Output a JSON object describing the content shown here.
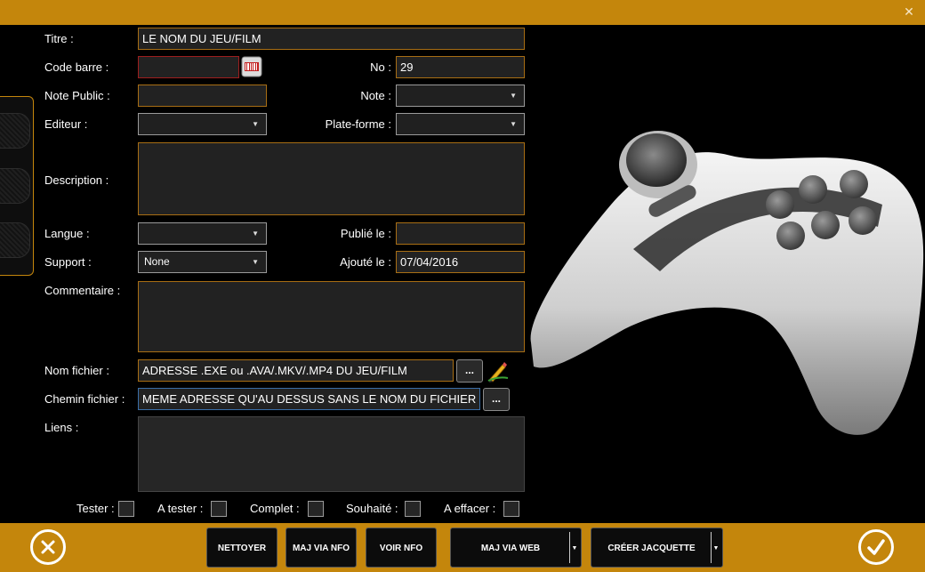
{
  "window": {
    "close_symbol": "✕"
  },
  "form": {
    "titre": {
      "label": "Titre :",
      "value": "LE NOM DU JEU/FILM"
    },
    "code_barre": {
      "label": "Code barre :",
      "value": ""
    },
    "no": {
      "label": "No :",
      "value": "29"
    },
    "note_public": {
      "label": "Note Public :",
      "value": ""
    },
    "note": {
      "label": "Note :",
      "value": ""
    },
    "editeur": {
      "label": "Editeur :",
      "value": ""
    },
    "plateforme": {
      "label": "Plate-forme :",
      "value": ""
    },
    "description": {
      "label": "Description :",
      "value": ""
    },
    "langue": {
      "label": "Langue :",
      "value": ""
    },
    "publie_le": {
      "label": "Publié le :",
      "value": ""
    },
    "support": {
      "label": "Support :",
      "value": "None"
    },
    "ajoute_le": {
      "label": "Ajouté le :",
      "value": "07/04/2016"
    },
    "commentaire": {
      "label": "Commentaire :",
      "value": ""
    },
    "nom_fichier": {
      "label": "Nom fichier :",
      "value": "ADRESSE .EXE ou .AVA/.MKV/.MP4 DU JEU/FILM",
      "browse": "..."
    },
    "chemin_fichier": {
      "label": "Chemin fichier :",
      "value": "MEME ADRESSE QU'AU DESSUS SANS LE NOM DU FICHIER",
      "browse": "..."
    },
    "liens": {
      "label": "Liens :",
      "value": ""
    }
  },
  "checkboxes": [
    {
      "label": "Tester :",
      "checked": false
    },
    {
      "label": "A tester :",
      "checked": false
    },
    {
      "label": "Complet :",
      "checked": false
    },
    {
      "label": "Souhaité :",
      "checked": false
    },
    {
      "label": "A effacer :",
      "checked": false
    }
  ],
  "actions": {
    "nettoyer": "NETTOYER",
    "maj_nfo": "MAJ VIA NFO",
    "voir_nfo": "VOIR NFO",
    "maj_web": "MAJ VIA WEB",
    "creer_jacquette": "CRÉER JACQUETTE"
  },
  "colors": {
    "accent": "#c4860c",
    "field_border": "#a86e14",
    "background": "#000000"
  },
  "icons": [
    "close-icon",
    "barcode-icon",
    "edit-pencil-icon",
    "cancel-circle-icon",
    "confirm-check-icon",
    "gamepad-image"
  ]
}
